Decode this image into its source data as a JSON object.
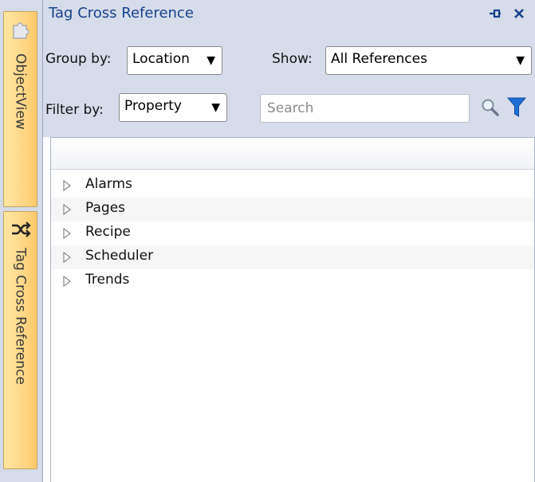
{
  "dock": {
    "tabs": [
      {
        "label": "ObjectView",
        "icon": "puzzle-icon"
      },
      {
        "label": "Tag Cross Reference",
        "icon": "shuffle-icon"
      }
    ]
  },
  "panel": {
    "title": "Tag Cross Reference",
    "pin_glyph": "⊣",
    "close_glyph": "✕"
  },
  "toolbar": {
    "group_by_label": "Group by:",
    "group_by_value": "Location",
    "show_label": "Show:",
    "show_value": "All References",
    "filter_by_label": "Filter by:",
    "filter_by_value": "Property",
    "search_placeholder": "Search",
    "dropdown_arrow": "▼"
  },
  "tree": {
    "items": [
      {
        "label": "Alarms"
      },
      {
        "label": "Pages"
      },
      {
        "label": "Recipe"
      },
      {
        "label": "Scheduler"
      },
      {
        "label": "Trends"
      }
    ]
  },
  "colors": {
    "title": "#15428b",
    "tab_yellow": "#ffd88a",
    "panel_bg": "#d7dcea",
    "filter_blue": "#1e6fd6"
  }
}
